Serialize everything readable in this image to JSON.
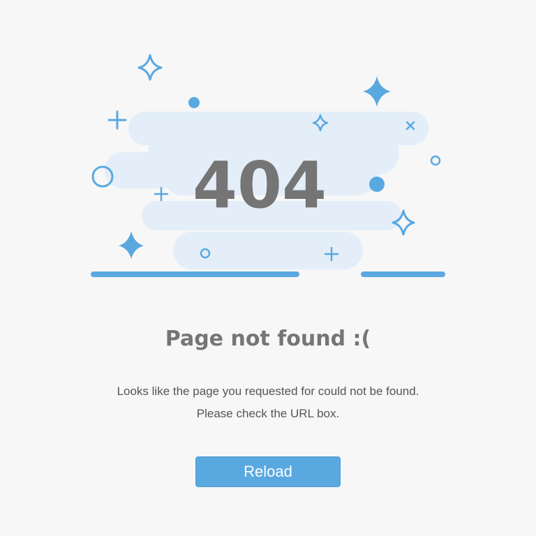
{
  "illustration": {
    "error_code": "404",
    "accent_color": "#5aa8e0",
    "cloud_color": "#e3eef9",
    "code_color": "#757575"
  },
  "content": {
    "title": "Page not found :(",
    "message_line1": "Looks like the page you requested for could not be found.",
    "message_line2": "Please check the URL box."
  },
  "actions": {
    "reload_label": "Reload"
  }
}
